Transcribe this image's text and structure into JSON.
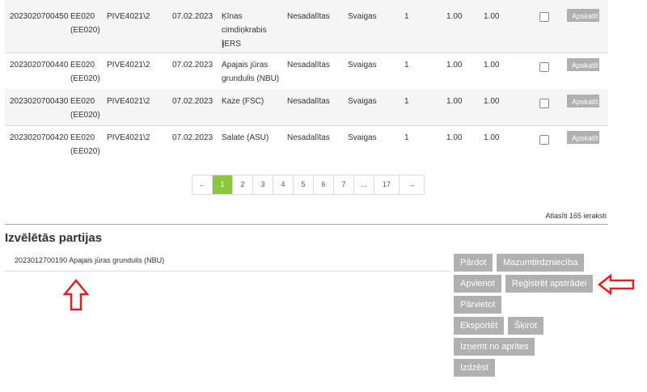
{
  "rows": [
    {
      "id": "2023020700450",
      "code1": "EE020",
      "code2": "(EE020)",
      "pive": "PIVE4021\\2",
      "date": "07.02.2023",
      "name": [
        "Ķīnas",
        "cimdiņkrabis (ERS",
        ")"
      ],
      "status": "Nesadalītas",
      "fresh": "Svaigas",
      "qty": "1",
      "v1": "1.00",
      "v2": "1.00",
      "view": "Apskatīt"
    },
    {
      "id": "2023020700440",
      "code1": "EE020",
      "code2": "(EE020)",
      "pive": "PIVE4021\\2",
      "date": "07.02.2023",
      "name": [
        "Apajais jūras",
        "grundulis (NBU)"
      ],
      "status": "Nesadalītas",
      "fresh": "Svaigas",
      "qty": "1",
      "v1": "1.00",
      "v2": "1.00",
      "view": "Apskatīt"
    },
    {
      "id": "2023020700430",
      "code1": "EE020",
      "code2": "(EE020)",
      "pive": "PIVE4021\\2",
      "date": "07.02.2023",
      "name": [
        "Kaze (FSC)"
      ],
      "status": "Nesadalītas",
      "fresh": "Svaigas",
      "qty": "1",
      "v1": "1.00",
      "v2": "1.00",
      "view": "Apskatīt"
    },
    {
      "id": "2023020700420",
      "code1": "EE020",
      "code2": "(EE020)",
      "pive": "PIVE4021\\2",
      "date": "07.02.2023",
      "name": [
        "Salate (ASU)"
      ],
      "status": "Nesadalītas",
      "fresh": "Svaigas",
      "qty": "1",
      "v1": "1.00",
      "v2": "1.00",
      "view": "Apskatīt"
    }
  ],
  "pagination": {
    "prev": "←",
    "pages": [
      "1",
      "2",
      "3",
      "4",
      "5",
      "6",
      "7",
      "...",
      "17"
    ],
    "next": "→",
    "active": "1"
  },
  "count_text": "Atlasīti 165 ieraksti",
  "section_title": "Izvēlētās partijas",
  "selected_item": "2023012700190 Apajais jūras grundulis (NBU)",
  "actions": {
    "sell": "Pārdot",
    "retail": "Mazumtirdzniecība",
    "merge": "Apvienot",
    "register": "Reģistrēt apstrādei",
    "move": "Pārvietot",
    "export": "Eksportēt",
    "split": "Šķirot",
    "remove": "Izņemt no aprites",
    "delete": "Izdzēst"
  },
  "colors": {
    "accent": "#8dc63f",
    "button": "#b0b0b0",
    "annotation": "#e02020"
  }
}
